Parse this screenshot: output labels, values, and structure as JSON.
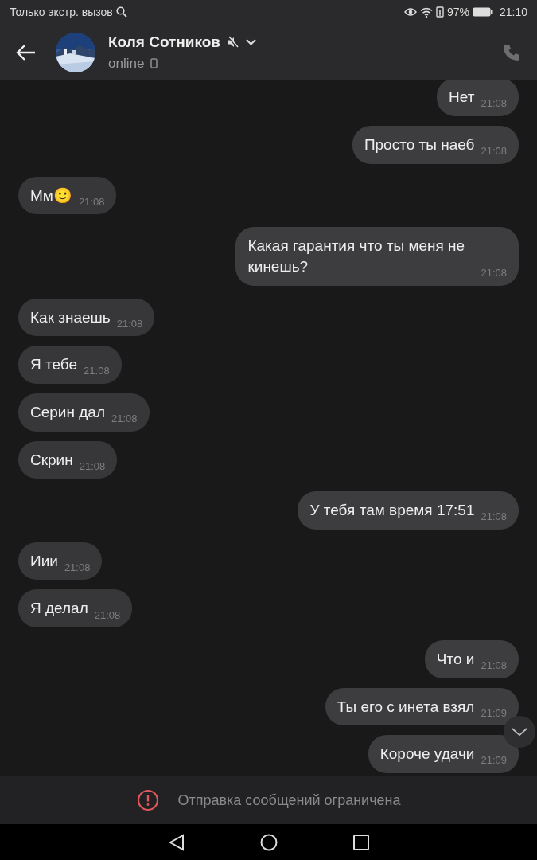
{
  "status_bar": {
    "carrier": "Только экстр. вызов",
    "battery": "97%",
    "time": "21:10"
  },
  "header": {
    "name": "Коля Сотников",
    "muted": true,
    "presence": "online"
  },
  "messages": [
    {
      "text": "Нет",
      "time": "21:08",
      "outgoing": true
    },
    {
      "text": "Просто ты наеб",
      "time": "21:08",
      "outgoing": true
    },
    {
      "text": "Мм",
      "emoji": "🙂",
      "time": "21:08",
      "outgoing": false
    },
    {
      "text": "Какая гарантия что ты меня не кинешь?",
      "time": "21:08",
      "outgoing": true
    },
    {
      "text": "Как знаешь",
      "time": "21:08",
      "outgoing": false
    },
    {
      "text": "Я тебе",
      "time": "21:08",
      "outgoing": false
    },
    {
      "text": "Серин дал",
      "time": "21:08",
      "outgoing": false
    },
    {
      "text": "Скрин",
      "time": "21:08",
      "outgoing": false
    },
    {
      "text": "У тебя там время 17:51",
      "time": "21:08",
      "outgoing": true
    },
    {
      "text": "Иии",
      "time": "21:08",
      "outgoing": false
    },
    {
      "text": "Я делал",
      "time": "21:08",
      "outgoing": false
    },
    {
      "text": "Что и",
      "time": "21:08",
      "outgoing": true
    },
    {
      "text": "Ты его с инета взял",
      "time": "21:09",
      "outgoing": true
    },
    {
      "text": "Короче удачи",
      "time": "21:09",
      "outgoing": true
    }
  ],
  "restriction": {
    "text": "Отправка сообщений ограничена"
  }
}
